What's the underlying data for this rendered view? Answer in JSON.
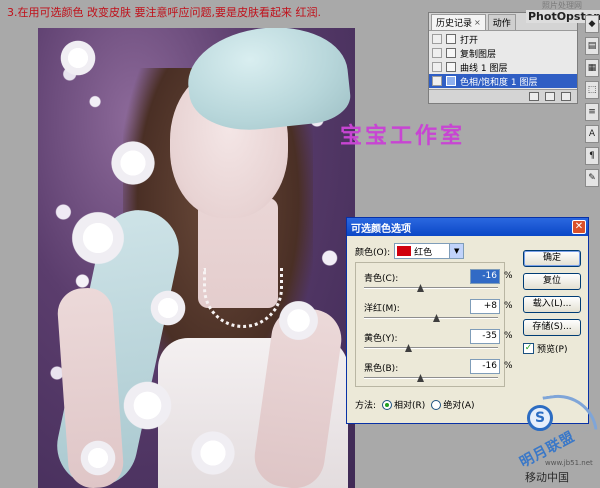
{
  "instruction": "3.在用可选颜色 改变皮肤 要注意呼应问题,要是皮肤看起来 红润.",
  "top_watermark": "照片处理网",
  "studio_watermark": "宝宝工作室",
  "ps_logo": "PhotOpstom",
  "history_panel": {
    "tabs": [
      {
        "label": "历史记录"
      },
      {
        "label": "动作"
      }
    ],
    "rows": [
      {
        "label": "打开",
        "selected": false
      },
      {
        "label": "复制图层",
        "selected": false
      },
      {
        "label": "曲线 1 图层",
        "selected": false
      },
      {
        "label": "色相/饱和度 1 图层",
        "selected": true
      }
    ]
  },
  "dialog": {
    "title": "可选颜色选项",
    "color_label": "颜色(O):",
    "color_value": "红色",
    "color_swatch": "#d0000d",
    "sliders": [
      {
        "label": "青色(C):",
        "value": "-16",
        "unit": "%",
        "position": 0.42
      },
      {
        "label": "洋红(M):",
        "value": "+8",
        "unit": "%",
        "position": 0.54
      },
      {
        "label": "黄色(Y):",
        "value": "-35",
        "unit": "%",
        "position": 0.33
      },
      {
        "label": "黑色(B):",
        "value": "-16",
        "unit": "%",
        "position": 0.42
      }
    ],
    "buttons": {
      "ok": "确定",
      "reset": "复位",
      "load": "载入(L)...",
      "save": "存储(S)..."
    },
    "preview_label": "预览(P)",
    "method_label": "方法:",
    "method_relative": "相对(R)",
    "method_absolute": "绝对(A)"
  },
  "brand": {
    "circle_letter": "S",
    "name": "明月联盟",
    "url": "www.jb51.net",
    "bottom_text": "移动中国"
  }
}
